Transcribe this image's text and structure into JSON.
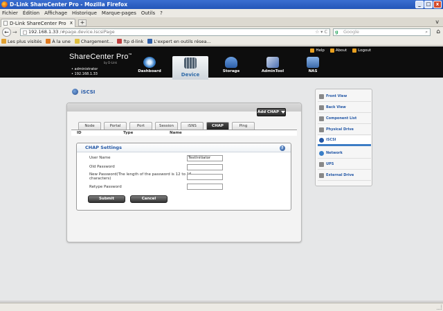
{
  "window": {
    "title": "D-Link ShareCenter Pro - Mozilla Firefox",
    "controls": [
      "_",
      "□",
      "x"
    ]
  },
  "menu": [
    "Fichier",
    "Édition",
    "Affichage",
    "Historique",
    "Marque-pages",
    "Outils",
    "?"
  ],
  "browser_tab": {
    "label": "D-Link ShareCenter Pro",
    "close": "x",
    "new_tab": "+",
    "overflow": "v"
  },
  "address": {
    "host": "192.168.1.33",
    "path": "/#page.device.IscsiPage",
    "suffix": "☆ ▾ C",
    "search_engine": "g",
    "search_placeholder": "Google",
    "search_glyph": "⌕",
    "back": "←",
    "forward": "→",
    "home": "⌂"
  },
  "bookmarks": [
    "Les plus visités",
    "À la une",
    "Chargement...",
    "ftp d-link",
    "L'expert en outils résea..."
  ],
  "header": {
    "brand": "ShareCenter Pro",
    "trademark": "™",
    "by": "by D-Link",
    "user": "administrator",
    "ip": "192.168.1.33",
    "links": [
      "Help",
      "About",
      "Logout"
    ],
    "tabs": [
      {
        "label": "Dashboard",
        "color": "#3a7fc7"
      },
      {
        "label": "Device",
        "color": "#6a7f94"
      },
      {
        "label": "Storage",
        "color": "#2d5fa8"
      },
      {
        "label": "AdminTool",
        "color": "#4b6fb2"
      },
      {
        "label": "NAS",
        "color": "#3b69a8"
      }
    ]
  },
  "section_title": "iSCSI",
  "panel": {
    "add_button": "Add CHAP",
    "tabs": [
      "Node",
      "Portal",
      "Port",
      "Session",
      "iSNS",
      "CHAP",
      "Ping"
    ],
    "active_tab": "CHAP",
    "columns": [
      "ID",
      "Type",
      "Name"
    ]
  },
  "chap": {
    "title": "CHAP Settings",
    "help": "?",
    "user_label": "User Name",
    "user_value": "TestInitiator",
    "old_label": "Old Password",
    "new_label_1": "New Password(The length of the password is 12 to 16",
    "new_label_2": "characters)",
    "retype_label": "Retype Password",
    "submit": "Submit",
    "cancel": "Cancel"
  },
  "sidebar": [
    "Front View",
    "Back View",
    "Component List",
    "Physical Drive",
    "iSCSI",
    "Network",
    "UPS",
    "External Drive"
  ],
  "sidebar_active": "iSCSI",
  "colors": {
    "accent": "#2458a6",
    "header_bg": "#0d0d0d",
    "page_bg": "#e6e7e8"
  }
}
